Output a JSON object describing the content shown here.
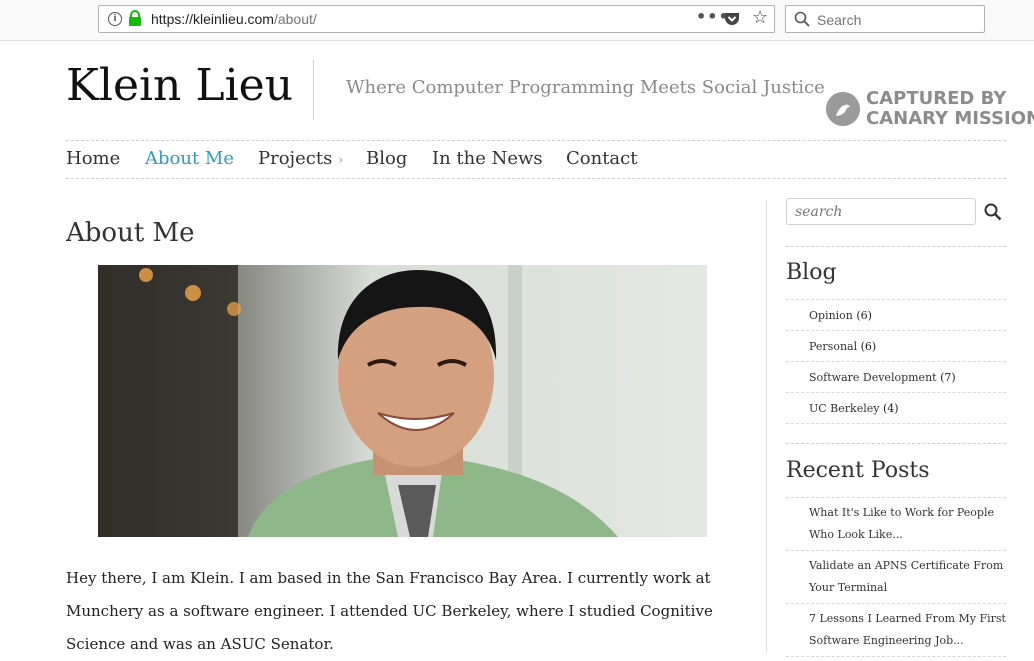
{
  "browser": {
    "url_host": "https://kleinlieu.com",
    "url_path": "/about/",
    "search_placeholder": "Search",
    "more_label": "•••",
    "star_label": "☆"
  },
  "header": {
    "site_title": "Klein Lieu",
    "tagline": "Where Computer Programming Meets Social Justice",
    "watermark_line1": "CAPTURED BY",
    "watermark_line2": "CANARY MISSION"
  },
  "nav": {
    "items": [
      {
        "label": "Home"
      },
      {
        "label": "About Me"
      },
      {
        "label": "Projects"
      },
      {
        "label": "Blog"
      },
      {
        "label": "In the News"
      },
      {
        "label": "Contact"
      }
    ],
    "projects_chevron": "›",
    "active_color": "#2a9bc2"
  },
  "main": {
    "heading": "About Me",
    "bio": "Hey there, I am Klein. I am based in the San Francisco Bay Area. I currently work at Munchery as a software engineer. I attended UC Berkeley, where I studied Cognitive Science and was an ASUC Senator."
  },
  "sidebar": {
    "search_placeholder": "search",
    "blog_title": "Blog",
    "categories": [
      {
        "name": "Opinion",
        "count": "(6)"
      },
      {
        "name": "Personal",
        "count": "(6)"
      },
      {
        "name": "Software Development",
        "count": "(7)"
      },
      {
        "name": "UC Berkeley",
        "count": "(4)"
      }
    ],
    "recent_title": "Recent Posts",
    "recent_posts": [
      {
        "title": "What It's Like to Work for People Who Look Like..."
      },
      {
        "title": "Validate an APNS Certificate From Your Terminal"
      },
      {
        "title": "7 Lessons I Learned From My First Software Engineering Job..."
      }
    ]
  },
  "icons": {
    "lock": "lock-icon",
    "info": "info-icon",
    "pocket": "pocket-icon",
    "star": "star-icon",
    "search": "search-icon"
  }
}
